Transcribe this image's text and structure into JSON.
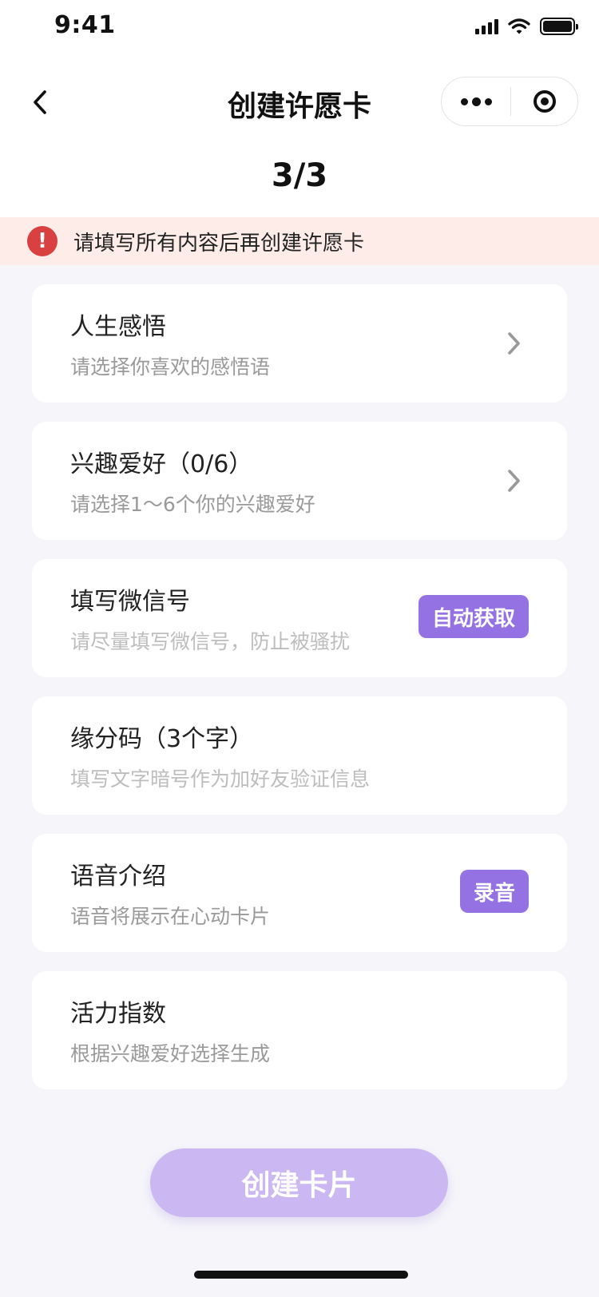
{
  "status_bar": {
    "time": "9:41"
  },
  "nav": {
    "title": "创建许愿卡"
  },
  "step": "3/3",
  "alert": {
    "icon_text": "!",
    "text": "请填写所有内容后再创建许愿卡"
  },
  "cards": [
    {
      "title": "人生感悟",
      "subtitle": "请选择你喜欢的感悟语",
      "action": "chevron"
    },
    {
      "title": "兴趣爱好（0/6）",
      "subtitle": "请选择1～6个你的兴趣爱好",
      "action": "chevron"
    },
    {
      "title": "填写微信号",
      "subtitle": "请尽量填写微信号，防止被骚扰",
      "action": "button",
      "button_label": "自动获取"
    },
    {
      "title": "缘分码（3个字）",
      "subtitle": "填写文字暗号作为加好友验证信息",
      "action": "none"
    },
    {
      "title": "语音介绍",
      "subtitle": "语音将展示在心动卡片",
      "action": "button",
      "button_label": "录音"
    },
    {
      "title": "活力指数",
      "subtitle": "根据兴趣爱好选择生成",
      "action": "none"
    }
  ],
  "create_button": {
    "label": "创建卡片"
  },
  "colors": {
    "accent": "#9472e3",
    "create_disabled": "#cbb7f1",
    "alert_bg": "#fdece8",
    "alert_icon": "#d94040"
  }
}
